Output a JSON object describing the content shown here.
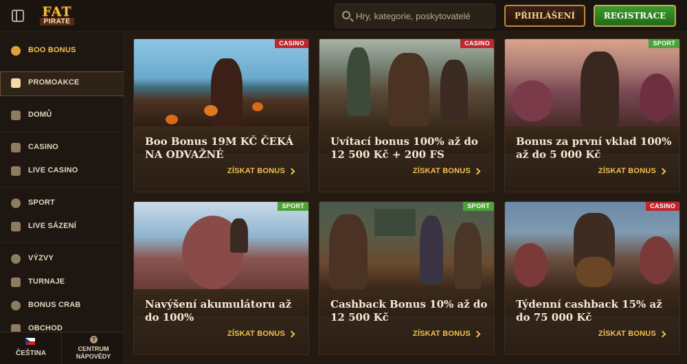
{
  "header": {
    "logo_top": "FAT",
    "logo_bottom": "PIRATE",
    "search_placeholder": "Hry, kategorie, poskytovatelé",
    "login_label": "PŘIHLÁŠENÍ",
    "register_label": "REGISTRACE"
  },
  "sidebar": {
    "items": [
      {
        "label": "BOO BONUS",
        "icon": "pumpkin-icon"
      },
      {
        "label": "PROMOAKCE",
        "icon": "treasure-chest-icon"
      },
      {
        "label": "DOMŮ",
        "icon": "home-icon"
      },
      {
        "label": "CASINO",
        "icon": "slot-machine-icon"
      },
      {
        "label": "LIVE CASINO",
        "icon": "cards-icon"
      },
      {
        "label": "SPORT",
        "icon": "soccer-ball-icon"
      },
      {
        "label": "LIVE SÁZENÍ",
        "icon": "live-icon"
      },
      {
        "label": "VÝZVY",
        "icon": "medal-icon"
      },
      {
        "label": "TURNAJE",
        "icon": "trophy-icon"
      },
      {
        "label": "BONUS CRAB",
        "icon": "crab-icon"
      },
      {
        "label": "OBCHOD",
        "icon": "shop-icon"
      }
    ],
    "language_label": "ČEŠTINA",
    "help_label_line1": "CENTRUM",
    "help_label_line2": "NÁPOVĚDY"
  },
  "cta_label": "ZÍSKAT BONUS",
  "cards": [
    {
      "tag": "CASINO",
      "title": "Boo Bonus 19M KČ ČEKÁ NA ODVAŽNÉ"
    },
    {
      "tag": "CASINO",
      "title": "Uvítací bonus 100% až do 12 500 Kč + 200 FS"
    },
    {
      "tag": "SPORT",
      "title": "Bonus za první vklad 100% až do 5 000 Kč"
    },
    {
      "tag": "SPORT",
      "title": "Navýšení akumulátoru až do 100%"
    },
    {
      "tag": "SPORT",
      "title": "Cashback Bonus 10% až do 12 500 Kč"
    },
    {
      "tag": "CASINO",
      "title": "Týdenní cashback 15% až do 75 000 Kč"
    }
  ],
  "colors": {
    "accent_gold": "#f2c24e",
    "casino_tag": "#c0272d",
    "sport_tag": "#4ea23a",
    "register_green": "#3c9b2c"
  }
}
